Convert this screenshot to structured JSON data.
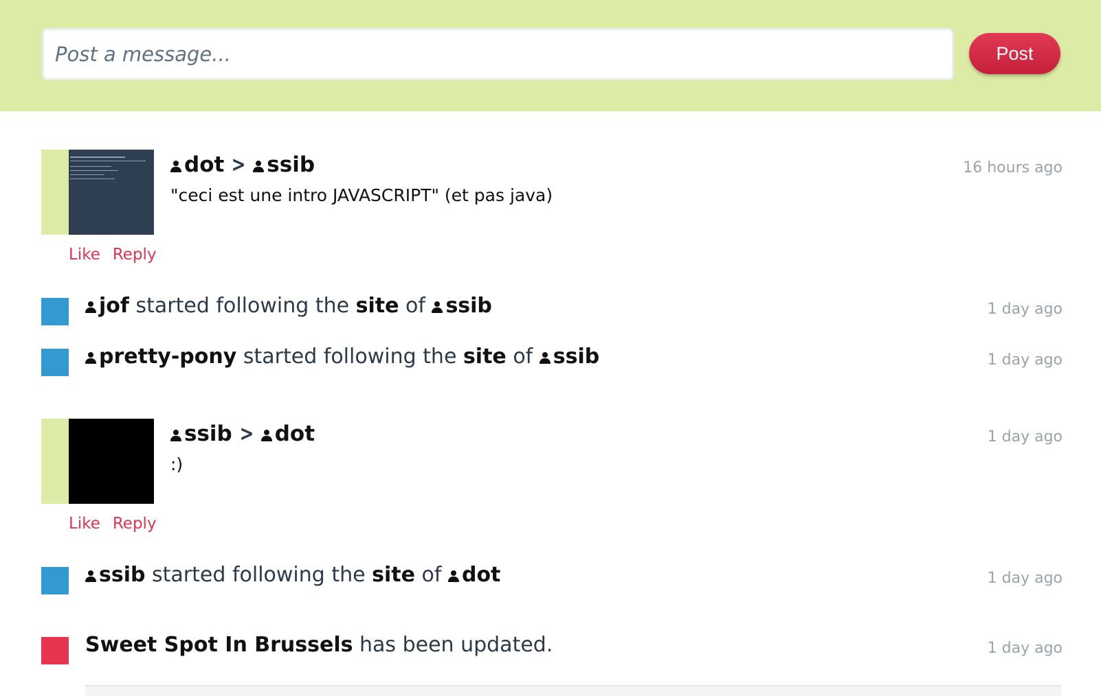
{
  "composer": {
    "placeholder": "Post a message...",
    "post_label": "Post"
  },
  "feed": {
    "post1": {
      "from": "dot",
      "to": "ssib",
      "text": "\"ceci est une intro JAVASCRIPT\" (et pas java)",
      "time": "16 hours ago",
      "like": "Like",
      "reply": "Reply"
    },
    "act1": {
      "user": "jof",
      "verb": "started following the",
      "object": "site",
      "prep": "of",
      "target": "ssib",
      "time": "1 day ago"
    },
    "act2": {
      "user": "pretty-pony",
      "verb": "started following the",
      "object": "site",
      "prep": "of",
      "target": "ssib",
      "time": "1 day ago"
    },
    "post2": {
      "from": "ssib",
      "to": "dot",
      "text": ":)",
      "time": "1 day ago",
      "like": "Like",
      "reply": "Reply"
    },
    "act3": {
      "user": "ssib",
      "verb": "started following the",
      "object": "site",
      "prep": "of",
      "target": "dot",
      "time": "1 day ago"
    },
    "update1": {
      "name": "Sweet Spot In Brussels",
      "text": "has been updated.",
      "time": "1 day ago"
    }
  },
  "colors": {
    "header_bg": "#dcecA6",
    "accent_red": "#e0334f",
    "follow_blue": "#3399d1",
    "update_red": "#e8354f"
  }
}
